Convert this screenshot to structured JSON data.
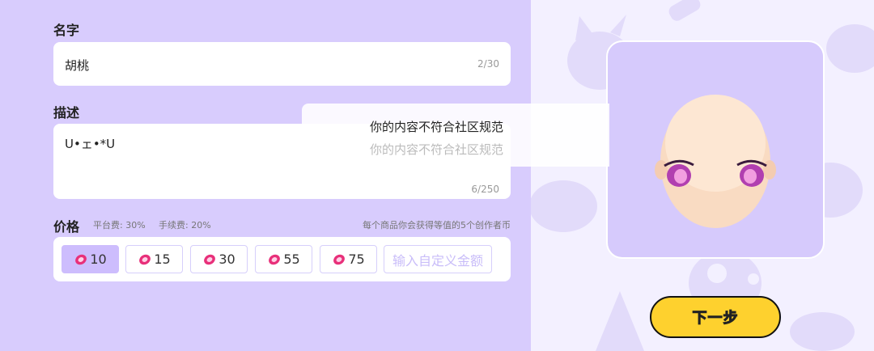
{
  "form": {
    "name": {
      "label": "名字",
      "value": "胡桃",
      "counter": "2/30"
    },
    "description": {
      "label": "描述",
      "value": "U•ェ•*U",
      "counter": "6/250"
    },
    "price": {
      "label": "价格",
      "platform_fee": "平台费: 30%",
      "handling_fee": "手续费: 20%",
      "earnings_note": "每个商品你会获得等值的5个创作者币",
      "options": [
        "10",
        "15",
        "30",
        "55",
        "75"
      ],
      "selected": "10",
      "custom_placeholder": "输入自定义金额"
    }
  },
  "toast": {
    "message": "你的内容不符合社区规范",
    "message_echo": "你的内容不符合社区规范"
  },
  "next_button": {
    "label": "下一步"
  },
  "colors": {
    "panel_bg": "#d8ccfd",
    "selected_option": "#cdbdfd",
    "accent_yellow": "#fed12e",
    "coin_pink": "#e8307a"
  },
  "icons": {
    "coin": "creator-coin-icon"
  }
}
